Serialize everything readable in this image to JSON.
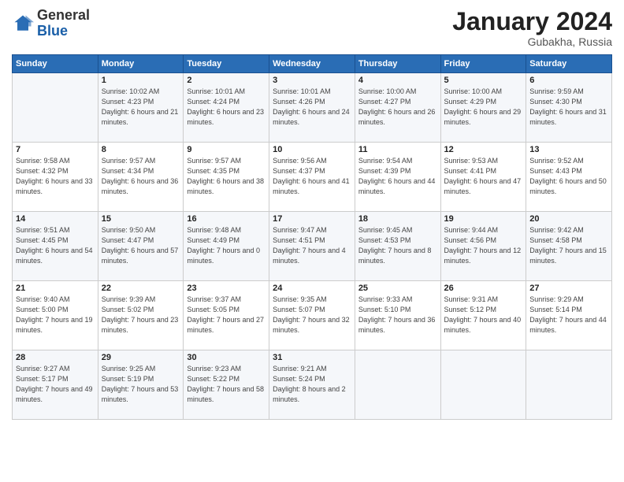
{
  "header": {
    "logo_general": "General",
    "logo_blue": "Blue",
    "month_title": "January 2024",
    "location": "Gubakha, Russia"
  },
  "days_of_week": [
    "Sunday",
    "Monday",
    "Tuesday",
    "Wednesday",
    "Thursday",
    "Friday",
    "Saturday"
  ],
  "weeks": [
    [
      {
        "day": "",
        "sunrise": "",
        "sunset": "",
        "daylight": ""
      },
      {
        "day": "1",
        "sunrise": "Sunrise: 10:02 AM",
        "sunset": "Sunset: 4:23 PM",
        "daylight": "Daylight: 6 hours and 21 minutes."
      },
      {
        "day": "2",
        "sunrise": "Sunrise: 10:01 AM",
        "sunset": "Sunset: 4:24 PM",
        "daylight": "Daylight: 6 hours and 23 minutes."
      },
      {
        "day": "3",
        "sunrise": "Sunrise: 10:01 AM",
        "sunset": "Sunset: 4:26 PM",
        "daylight": "Daylight: 6 hours and 24 minutes."
      },
      {
        "day": "4",
        "sunrise": "Sunrise: 10:00 AM",
        "sunset": "Sunset: 4:27 PM",
        "daylight": "Daylight: 6 hours and 26 minutes."
      },
      {
        "day": "5",
        "sunrise": "Sunrise: 10:00 AM",
        "sunset": "Sunset: 4:29 PM",
        "daylight": "Daylight: 6 hours and 29 minutes."
      },
      {
        "day": "6",
        "sunrise": "Sunrise: 9:59 AM",
        "sunset": "Sunset: 4:30 PM",
        "daylight": "Daylight: 6 hours and 31 minutes."
      }
    ],
    [
      {
        "day": "7",
        "sunrise": "Sunrise: 9:58 AM",
        "sunset": "Sunset: 4:32 PM",
        "daylight": "Daylight: 6 hours and 33 minutes."
      },
      {
        "day": "8",
        "sunrise": "Sunrise: 9:57 AM",
        "sunset": "Sunset: 4:34 PM",
        "daylight": "Daylight: 6 hours and 36 minutes."
      },
      {
        "day": "9",
        "sunrise": "Sunrise: 9:57 AM",
        "sunset": "Sunset: 4:35 PM",
        "daylight": "Daylight: 6 hours and 38 minutes."
      },
      {
        "day": "10",
        "sunrise": "Sunrise: 9:56 AM",
        "sunset": "Sunset: 4:37 PM",
        "daylight": "Daylight: 6 hours and 41 minutes."
      },
      {
        "day": "11",
        "sunrise": "Sunrise: 9:54 AM",
        "sunset": "Sunset: 4:39 PM",
        "daylight": "Daylight: 6 hours and 44 minutes."
      },
      {
        "day": "12",
        "sunrise": "Sunrise: 9:53 AM",
        "sunset": "Sunset: 4:41 PM",
        "daylight": "Daylight: 6 hours and 47 minutes."
      },
      {
        "day": "13",
        "sunrise": "Sunrise: 9:52 AM",
        "sunset": "Sunset: 4:43 PM",
        "daylight": "Daylight: 6 hours and 50 minutes."
      }
    ],
    [
      {
        "day": "14",
        "sunrise": "Sunrise: 9:51 AM",
        "sunset": "Sunset: 4:45 PM",
        "daylight": "Daylight: 6 hours and 54 minutes."
      },
      {
        "day": "15",
        "sunrise": "Sunrise: 9:50 AM",
        "sunset": "Sunset: 4:47 PM",
        "daylight": "Daylight: 6 hours and 57 minutes."
      },
      {
        "day": "16",
        "sunrise": "Sunrise: 9:48 AM",
        "sunset": "Sunset: 4:49 PM",
        "daylight": "Daylight: 7 hours and 0 minutes."
      },
      {
        "day": "17",
        "sunrise": "Sunrise: 9:47 AM",
        "sunset": "Sunset: 4:51 PM",
        "daylight": "Daylight: 7 hours and 4 minutes."
      },
      {
        "day": "18",
        "sunrise": "Sunrise: 9:45 AM",
        "sunset": "Sunset: 4:53 PM",
        "daylight": "Daylight: 7 hours and 8 minutes."
      },
      {
        "day": "19",
        "sunrise": "Sunrise: 9:44 AM",
        "sunset": "Sunset: 4:56 PM",
        "daylight": "Daylight: 7 hours and 12 minutes."
      },
      {
        "day": "20",
        "sunrise": "Sunrise: 9:42 AM",
        "sunset": "Sunset: 4:58 PM",
        "daylight": "Daylight: 7 hours and 15 minutes."
      }
    ],
    [
      {
        "day": "21",
        "sunrise": "Sunrise: 9:40 AM",
        "sunset": "Sunset: 5:00 PM",
        "daylight": "Daylight: 7 hours and 19 minutes."
      },
      {
        "day": "22",
        "sunrise": "Sunrise: 9:39 AM",
        "sunset": "Sunset: 5:02 PM",
        "daylight": "Daylight: 7 hours and 23 minutes."
      },
      {
        "day": "23",
        "sunrise": "Sunrise: 9:37 AM",
        "sunset": "Sunset: 5:05 PM",
        "daylight": "Daylight: 7 hours and 27 minutes."
      },
      {
        "day": "24",
        "sunrise": "Sunrise: 9:35 AM",
        "sunset": "Sunset: 5:07 PM",
        "daylight": "Daylight: 7 hours and 32 minutes."
      },
      {
        "day": "25",
        "sunrise": "Sunrise: 9:33 AM",
        "sunset": "Sunset: 5:10 PM",
        "daylight": "Daylight: 7 hours and 36 minutes."
      },
      {
        "day": "26",
        "sunrise": "Sunrise: 9:31 AM",
        "sunset": "Sunset: 5:12 PM",
        "daylight": "Daylight: 7 hours and 40 minutes."
      },
      {
        "day": "27",
        "sunrise": "Sunrise: 9:29 AM",
        "sunset": "Sunset: 5:14 PM",
        "daylight": "Daylight: 7 hours and 44 minutes."
      }
    ],
    [
      {
        "day": "28",
        "sunrise": "Sunrise: 9:27 AM",
        "sunset": "Sunset: 5:17 PM",
        "daylight": "Daylight: 7 hours and 49 minutes."
      },
      {
        "day": "29",
        "sunrise": "Sunrise: 9:25 AM",
        "sunset": "Sunset: 5:19 PM",
        "daylight": "Daylight: 7 hours and 53 minutes."
      },
      {
        "day": "30",
        "sunrise": "Sunrise: 9:23 AM",
        "sunset": "Sunset: 5:22 PM",
        "daylight": "Daylight: 7 hours and 58 minutes."
      },
      {
        "day": "31",
        "sunrise": "Sunrise: 9:21 AM",
        "sunset": "Sunset: 5:24 PM",
        "daylight": "Daylight: 8 hours and 2 minutes."
      },
      {
        "day": "",
        "sunrise": "",
        "sunset": "",
        "daylight": ""
      },
      {
        "day": "",
        "sunrise": "",
        "sunset": "",
        "daylight": ""
      },
      {
        "day": "",
        "sunrise": "",
        "sunset": "",
        "daylight": ""
      }
    ]
  ]
}
